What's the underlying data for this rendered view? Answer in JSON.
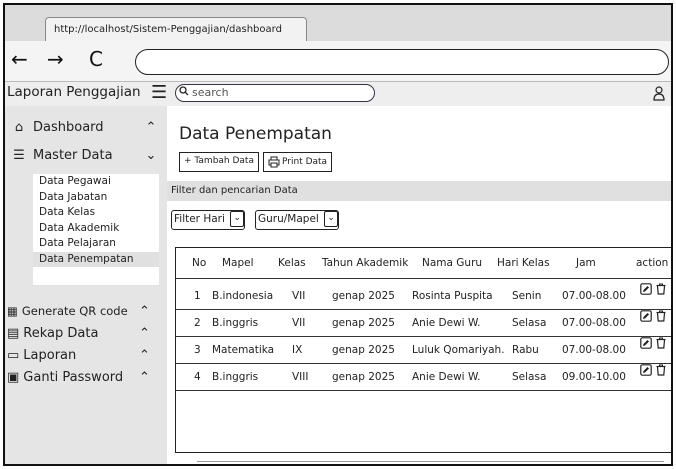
{
  "browser": {
    "tab_title": "http://localhost/Sistem-Penggajian/dashboard",
    "nav": {
      "back": "←",
      "forward": "→",
      "reload": "C"
    },
    "url_value": ""
  },
  "app": {
    "title": "Laporan Penggajian",
    "menu_icon": "hamburger-icon",
    "search_placeholder": "search",
    "user_icon": "user-icon"
  },
  "sidebar": {
    "dashboard": "Dashboard",
    "master_data": "Master Data",
    "submenu": [
      "Data Pegawai",
      "Data Jabatan",
      "Data Kelas",
      "Data Akademik",
      "Data Pelajaran",
      "Data Penempatan"
    ],
    "active_submenu": "Data Penempatan",
    "generate_qr": "Generate QR code",
    "rekap_data": "Rekap Data",
    "laporan": "Laporan",
    "ganti_password": "Ganti Password"
  },
  "main": {
    "title": "Data Penempatan",
    "add_button": "+ Tambah Data",
    "print_button": "Print Data",
    "filter_title": "Filter dan pencarian Data",
    "filter_day": "Filter Hari",
    "filter_teacher": "Guru/Mapel"
  },
  "table": {
    "columns": [
      "No",
      "Mapel",
      "Kelas",
      "Tahun Akademik",
      "Nama Guru",
      "Hari Kelas",
      "Jam",
      "action"
    ],
    "rows": [
      {
        "no": "1",
        "mapel": "B.indonesia",
        "kelas": "VII",
        "tahun": "genap 2025",
        "guru": "Rosinta Puspita",
        "hari": "Senin",
        "jam": "07.00-08.00"
      },
      {
        "no": "2",
        "mapel": "B.inggris",
        "kelas": "VII",
        "tahun": "genap 2025",
        "guru": "Anie Dewi W.",
        "hari": "Selasa",
        "jam": "07.00-08.00"
      },
      {
        "no": "3",
        "mapel": "Matematika",
        "kelas": "IX",
        "tahun": "genap 2025",
        "guru": "Luluk Qomariyah.",
        "hari": "Rabu",
        "jam": "07.00-08.00"
      },
      {
        "no": "4",
        "mapel": "B.inggris",
        "kelas": "VIII",
        "tahun": "genap 2025",
        "guru": "Anie Dewi W.",
        "hari": "Selasa",
        "jam": "09.00-10.00"
      }
    ]
  }
}
